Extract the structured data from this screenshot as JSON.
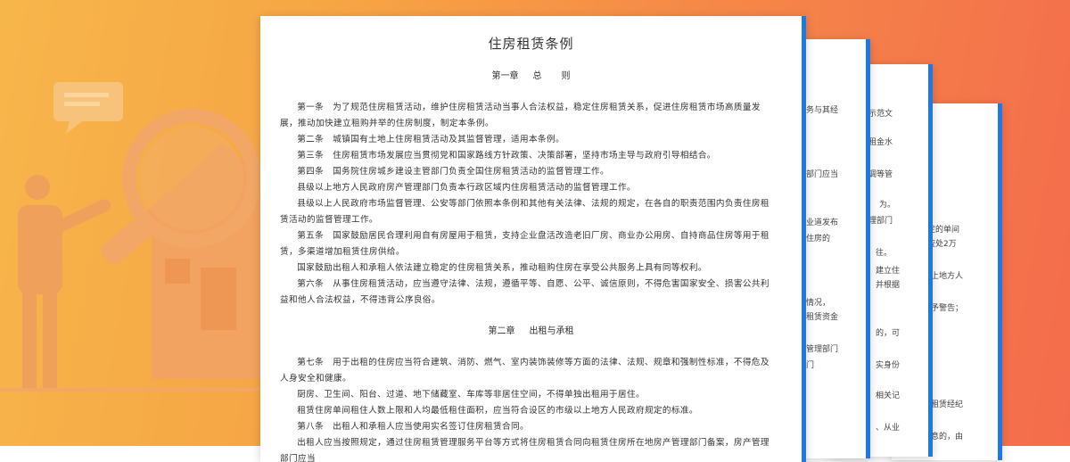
{
  "document": {
    "title": "住房租赁条例",
    "chapter1": {
      "label": "第一章",
      "name": "总",
      "name2": "则"
    },
    "chapter1_paragraphs": [
      "第一条　为了规范住房租赁活动，维护住房租赁活动当事人合法权益，稳定住房租赁关系，促进住房租赁市场高质量发展，推动加快建立租购并举的住房制度，制定本条例。",
      "第二条　城镇国有土地上住房租赁活动及其监督管理，适用本条例。",
      "第三条　住房租赁市场发展应当贯彻党和国家路线方针政策、决策部署，坚持市场主导与政府引导相结合。",
      "第四条　国务院住房城乡建设主管部门负责全国住房租赁活动的监督管理工作。",
      "县级以上地方人民政府房产管理部门负责本行政区域内住房租赁活动的监督管理工作。",
      "县级以上人民政府市场监督管理、公安等部门依照本条例和其他有关法律、法规的规定，在各自的职责范围内负责住房租赁活动的监督管理工作。",
      "第五条　国家鼓励居民合理利用自有房屋用于租赁，支持企业盘活改造老旧厂房、商业办公用房、自持商品住房等用于租赁，多渠道增加租赁住房供给。",
      "国家鼓励出租人和承租人依法建立稳定的住房租赁关系，推动租购住房在享受公共服务上具有同等权利。",
      "第六条　从事住房租赁活动，应当遵守法律、法规，遵循平等、自愿、公平、诚信原则，不得危害国家安全、损害公共利益和他人合法权益，不得违背公序良俗。"
    ],
    "chapter2": {
      "label": "第二章",
      "name": "出租与承租"
    },
    "chapter2_paragraphs": [
      "第七条　用于出租的住房应当符合建筑、消防、燃气、室内装饰装修等方面的法律、法规、规章和强制性标准，不得危及人身安全和健康。",
      "厨房、卫生间、阳台、过道、地下储藏室、车库等非居住空间，不得单独出租用于居住。",
      "租赁住房单间租住人数上限和人均最低租住面积，应当符合设区的市级以上地方人民政府规定的标准。",
      "第八条　出租人和承租人应当使用实名签订住房租赁合同。",
      "出租人应当按照规定，通过住房租赁管理服务平台等方式将住房租赁合同向租赁住房所在地房产管理部门备案，房产管理部门应当"
    ]
  },
  "page2_fragments": [
    "务与其经",
    "部门应当",
    "业道发布",
    "住房的",
    "情况，",
    "租赁资金",
    "管理部门",
    "门"
  ],
  "page3_fragments": [
    "示范文",
    "租金水",
    "调等管",
    "为。",
    "理部门",
    "往。",
    "建立住",
    "并根据",
    "的，可",
    "实身份",
    "相关记",
    "、从业"
  ],
  "page4_fragments": [
    "定的单间",
    "应处2万",
    "上地方人",
    "予警告；",
    "租赁经纪",
    "息的，由"
  ]
}
